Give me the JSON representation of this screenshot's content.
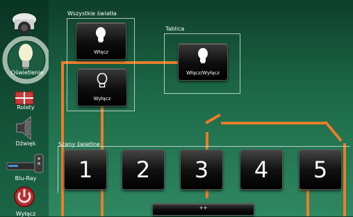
{
  "sidebar": {
    "items": [
      {
        "label": ""
      },
      {
        "label": "Oświetlenie",
        "active": true
      },
      {
        "label": "Rolety"
      },
      {
        "label": "Dźwięk"
      },
      {
        "label": "Blu-Ray"
      },
      {
        "label": "Wyłącz"
      }
    ]
  },
  "panels": {
    "all_lights": {
      "title": "Wszystkie światła",
      "on_label": "Włącz",
      "off_label": "Wyłącz"
    },
    "board": {
      "title": "Tablica",
      "toggle_label": "Włącz/Wyłącz"
    },
    "scenes": {
      "title": "Sceny świetlne",
      "buttons": [
        "1",
        "2",
        "3",
        "4",
        "5"
      ],
      "more_label": "++"
    }
  },
  "colors": {
    "wire": "#e87d2c",
    "highlight_ring": "#9fb8a8",
    "background": "#1d6a49"
  }
}
